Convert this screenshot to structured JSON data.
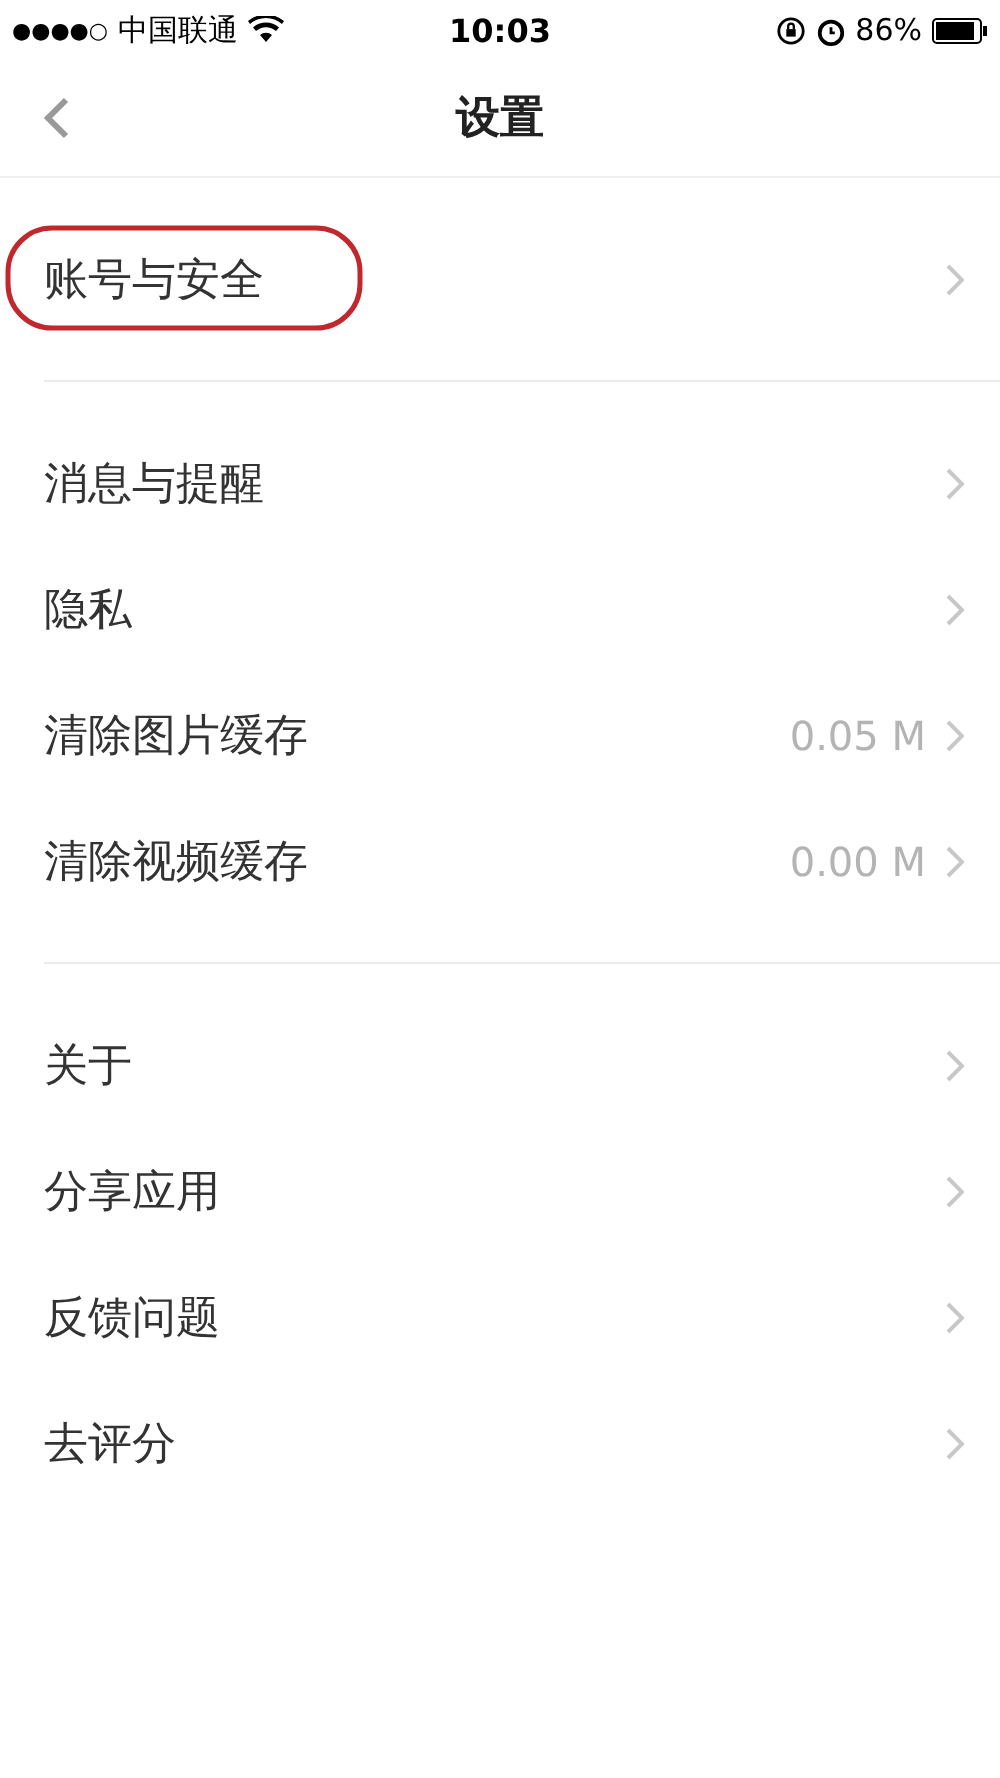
{
  "status_bar": {
    "signal": "●●●●○",
    "carrier": "中国联通",
    "time": "10:03",
    "battery": "86%"
  },
  "nav": {
    "title": "设置"
  },
  "groups": [
    {
      "items": [
        {
          "label": "账号与安全",
          "highlighted": true
        }
      ]
    },
    {
      "items": [
        {
          "label": "消息与提醒",
          "highlighted": false
        },
        {
          "label": "隐私",
          "highlighted": false
        },
        {
          "label": "清除图片缓存",
          "value": "0.05 M",
          "highlighted": false
        },
        {
          "label": "清除视频缓存",
          "value": "0.00 M",
          "highlighted": false
        }
      ]
    },
    {
      "items": [
        {
          "label": "关于",
          "highlighted": false
        },
        {
          "label": "分享应用",
          "highlighted": false
        },
        {
          "label": "反馈问题",
          "highlighted": false
        },
        {
          "label": "去评分",
          "highlighted": false
        }
      ]
    }
  ]
}
